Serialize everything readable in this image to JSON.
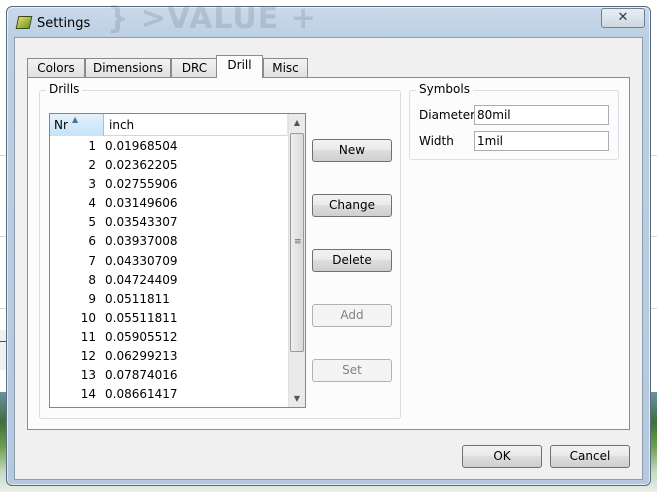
{
  "window": {
    "title": "Settings",
    "ghost_background_text": "  }  >VALUE +",
    "close_glyph": "✕"
  },
  "tabs": [
    {
      "label": "Colors",
      "active": false
    },
    {
      "label": "Dimensions",
      "active": false
    },
    {
      "label": "DRC",
      "active": false
    },
    {
      "label": "Drill",
      "active": true
    },
    {
      "label": "Misc",
      "active": false
    }
  ],
  "drills": {
    "group_label": "Drills",
    "columns": {
      "nr": "Nr",
      "inch": "inch"
    },
    "rows": [
      {
        "nr": "1",
        "inch": "0.01968504"
      },
      {
        "nr": "2",
        "inch": "0.02362205"
      },
      {
        "nr": "3",
        "inch": "0.02755906"
      },
      {
        "nr": "4",
        "inch": "0.03149606"
      },
      {
        "nr": "5",
        "inch": "0.03543307"
      },
      {
        "nr": "6",
        "inch": "0.03937008"
      },
      {
        "nr": "7",
        "inch": "0.04330709"
      },
      {
        "nr": "8",
        "inch": "0.04724409"
      },
      {
        "nr": "9",
        "inch": "0.0511811"
      },
      {
        "nr": "10",
        "inch": "0.05511811"
      },
      {
        "nr": "11",
        "inch": "0.05905512"
      },
      {
        "nr": "12",
        "inch": "0.06299213"
      },
      {
        "nr": "13",
        "inch": "0.07874016"
      },
      {
        "nr": "14",
        "inch": "0.08661417"
      }
    ],
    "buttons": {
      "new": "New",
      "change": "Change",
      "delete": "Delete",
      "add": "Add",
      "set": "Set"
    }
  },
  "symbols": {
    "group_label": "Symbols",
    "diameter_label": "Diameter",
    "diameter_value": "80mil",
    "width_label": "Width",
    "width_value": "1mil"
  },
  "footer": {
    "ok": "OK",
    "cancel": "Cancel"
  },
  "colors": {
    "accent_header": "#c5e3f8",
    "disabled_text": "#838383"
  }
}
